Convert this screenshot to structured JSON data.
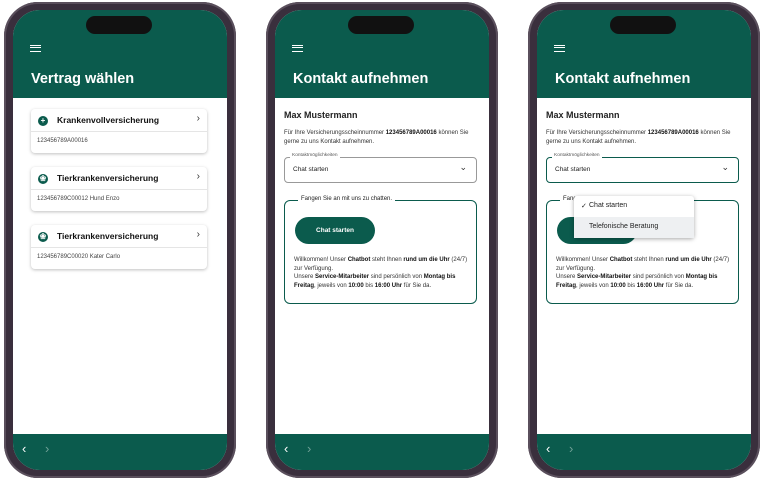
{
  "nav": {
    "menu_icon": "hamburger-icon",
    "back_icon": "‹",
    "forward_icon": "›"
  },
  "colors": {
    "brand": "#0b5b4d",
    "frame": "#3a2f3d"
  },
  "screen1": {
    "title": "Vertrag wählen",
    "cards": [
      {
        "icon": "plus-circle-icon",
        "icon_glyph": "+",
        "title": "Krankenvollversicherung",
        "subtitle": "123456789A00016"
      },
      {
        "icon": "paw-icon",
        "icon_glyph": "❀",
        "title": "Tierkrankenversicherung",
        "subtitle": "123456789C00012 Hund Enzo"
      },
      {
        "icon": "paw-icon",
        "icon_glyph": "❀",
        "title": "Tierkrankenversicherung",
        "subtitle": "123456789C00020 Kater Carlo"
      }
    ]
  },
  "contact": {
    "title": "Kontakt aufnehmen",
    "name": "Max Mustermann",
    "intro_pre": "Für Ihre Versicherungsscheinnummer ",
    "intro_number": "123456789A00016",
    "intro_post": " können Sie gerne zu uns Kontakt aufnehmen.",
    "select_label": "Kontaktmöglichkeiten",
    "select_value": "Chat starten",
    "box_legend": "Fangen Sie an mit uns zu chatten.",
    "box_legend_partial": "Fange",
    "chat_button": "Chat starten",
    "text_1": "Willkommen! Unser ",
    "text_chatbot": "Chatbot",
    "text_2": " steht Ihnen ",
    "text_rund": "rund um die Uhr",
    "text_3": " (24/7) zur Verfügung.",
    "text_4": "Unsere ",
    "text_service": "Service-Mitarbeiter",
    "text_5": " sind persönlich von ",
    "text_days": "Montag bis Freitag",
    "text_6": ", jeweils von ",
    "text_time1": "10:00",
    "text_7": " bis ",
    "text_time2": "16:00 Uhr",
    "text_8": " für Sie da."
  },
  "dropdown": {
    "options": [
      "Chat starten",
      "Telefonische Beratung"
    ],
    "selected": "Chat starten",
    "check": "✓"
  }
}
